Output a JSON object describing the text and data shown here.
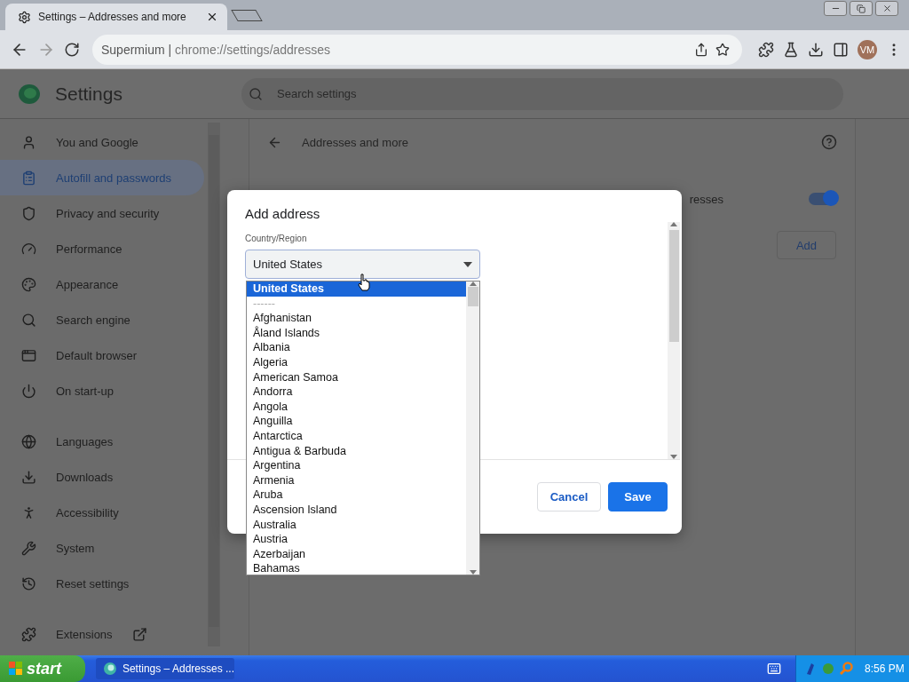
{
  "browser": {
    "tab_title": "Settings – Addresses and more",
    "omnibox": {
      "site": "Supermium",
      "separator": "|",
      "url_host": "chrome://settings",
      "url_path": "/addresses"
    },
    "profile_initials": "VM"
  },
  "settings": {
    "title": "Settings",
    "search_placeholder": "Search settings",
    "sidebar_groups": [
      {
        "items": [
          {
            "label": "You and Google",
            "selected": false
          },
          {
            "label": "Autofill and passwords",
            "selected": true
          },
          {
            "label": "Privacy and security",
            "selected": false
          },
          {
            "label": "Performance",
            "selected": false
          },
          {
            "label": "Appearance",
            "selected": false
          },
          {
            "label": "Search engine",
            "selected": false
          },
          {
            "label": "Default browser",
            "selected": false
          },
          {
            "label": "On start-up",
            "selected": false
          }
        ]
      },
      {
        "items": [
          {
            "label": "Languages",
            "selected": false
          },
          {
            "label": "Downloads",
            "selected": false
          },
          {
            "label": "Accessibility",
            "selected": false
          },
          {
            "label": "System",
            "selected": false
          },
          {
            "label": "Reset settings",
            "selected": false
          }
        ]
      },
      {
        "items": [
          {
            "label": "Extensions",
            "selected": false,
            "external": true
          }
        ]
      }
    ],
    "page": {
      "title": "Addresses and more",
      "setting_text": "resses",
      "toggle": {
        "on": true
      },
      "add_button": "Add"
    }
  },
  "dialog": {
    "title": "Add address",
    "field_label": "Country/Region",
    "select_value": "United States",
    "buttons": [
      {
        "label": "Cancel",
        "kind": "secondary"
      },
      {
        "label": "Save",
        "kind": "primary"
      }
    ]
  },
  "dropdown": {
    "options": [
      {
        "label": "United States",
        "selected": true,
        "disabled": false
      },
      {
        "label": "------",
        "selected": false,
        "disabled": true
      },
      {
        "label": "Afghanistan",
        "selected": false,
        "disabled": false
      },
      {
        "label": "Åland Islands",
        "selected": false,
        "disabled": false
      },
      {
        "label": "Albania",
        "selected": false,
        "disabled": false
      },
      {
        "label": "Algeria",
        "selected": false,
        "disabled": false
      },
      {
        "label": "American Samoa",
        "selected": false,
        "disabled": false
      },
      {
        "label": "Andorra",
        "selected": false,
        "disabled": false
      },
      {
        "label": "Angola",
        "selected": false,
        "disabled": false
      },
      {
        "label": "Anguilla",
        "selected": false,
        "disabled": false
      },
      {
        "label": "Antarctica",
        "selected": false,
        "disabled": false
      },
      {
        "label": "Antigua & Barbuda",
        "selected": false,
        "disabled": false
      },
      {
        "label": "Argentina",
        "selected": false,
        "disabled": false
      },
      {
        "label": "Armenia",
        "selected": false,
        "disabled": false
      },
      {
        "label": "Aruba",
        "selected": false,
        "disabled": false
      },
      {
        "label": "Ascension Island",
        "selected": false,
        "disabled": false
      },
      {
        "label": "Australia",
        "selected": false,
        "disabled": false
      },
      {
        "label": "Austria",
        "selected": false,
        "disabled": false
      },
      {
        "label": "Azerbaijan",
        "selected": false,
        "disabled": false
      },
      {
        "label": "Bahamas",
        "selected": false,
        "disabled": false
      }
    ]
  },
  "taskbar": {
    "start_label": "start",
    "task_label": "Settings – Addresses ...",
    "clock": "8:56 PM"
  }
}
